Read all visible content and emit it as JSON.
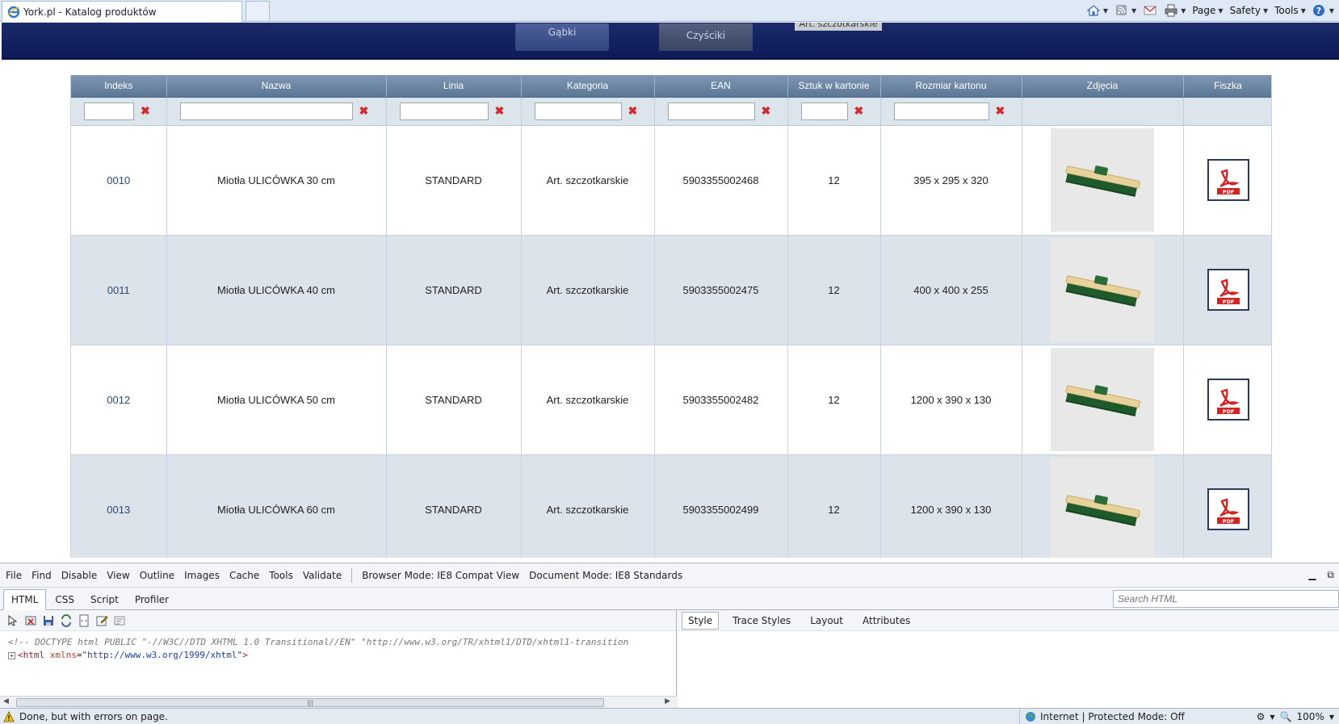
{
  "browser": {
    "tab_title": "York.pl - Katalog produktów",
    "commands": [
      "Page",
      "Safety",
      "Tools"
    ]
  },
  "banner": {
    "tabs": [
      "Gąbki",
      "Czyściki",
      "Art. szczotkarskie"
    ]
  },
  "table": {
    "headers": [
      "Indeks",
      "Nazwa",
      "Linia",
      "Kategoria",
      "EAN",
      "Sztuk w kartonie",
      "Rozmiar kartonu",
      "Zdjęcia",
      "Fiszka"
    ],
    "rows": [
      {
        "index": "0010",
        "name": "Miotła ULICÓWKA 30 cm",
        "line": "STANDARD",
        "category": "Art. szczotkarskie",
        "ean": "5903355002468",
        "pcs": "12",
        "box_size": "395 x 295 x 320"
      },
      {
        "index": "0011",
        "name": "Miotła ULICÓWKA 40 cm",
        "line": "STANDARD",
        "category": "Art. szczotkarskie",
        "ean": "5903355002475",
        "pcs": "12",
        "box_size": "400 x 400 x 255"
      },
      {
        "index": "0012",
        "name": "Miotła ULICÓWKA 50 cm",
        "line": "STANDARD",
        "category": "Art. szczotkarskie",
        "ean": "5903355002482",
        "pcs": "12",
        "box_size": "1200 x 390 x 130"
      },
      {
        "index": "0013",
        "name": "Miotła ULICÓWKA 60 cm",
        "line": "STANDARD",
        "category": "Art. szczotkarskie",
        "ean": "5903355002499",
        "pcs": "12",
        "box_size": "1200 x 390 x 130"
      }
    ],
    "pdf_label": "PDF"
  },
  "devtools": {
    "menu": [
      "File",
      "Find",
      "Disable",
      "View",
      "Outline",
      "Images",
      "Cache",
      "Tools",
      "Validate"
    ],
    "browser_mode": "Browser Mode: IE8 Compat View",
    "document_mode": "Document Mode: IE8 Standards",
    "tabs": [
      "HTML",
      "CSS",
      "Script",
      "Profiler"
    ],
    "search_placeholder": "Search HTML",
    "doctype_line": "<!-- DOCTYPE html PUBLIC \"-//W3C//DTD XHTML 1.0 Transitional//EN\" \"http://www.w3.org/TR/xhtml1/DTD/xhtml1-transition",
    "html_tag": "html",
    "html_attr": "xmlns",
    "html_attr_value": "\"http://www.w3.org/1999/xhtml\"",
    "sub_tabs": [
      "Style",
      "Trace Styles",
      "Layout",
      "Attributes"
    ]
  },
  "status": {
    "text": "Done, but with errors on page.",
    "zone": "Internet | Protected Mode: Off",
    "zoom": "100%"
  },
  "colors": {
    "banner": "#1c2a6b",
    "header": "#6c86a5",
    "row_alt": "#dde3ea",
    "clear_icon": "#d42a2a",
    "broom_bristle": "#1f5a2c",
    "broom_wood": "#e8d29c"
  }
}
